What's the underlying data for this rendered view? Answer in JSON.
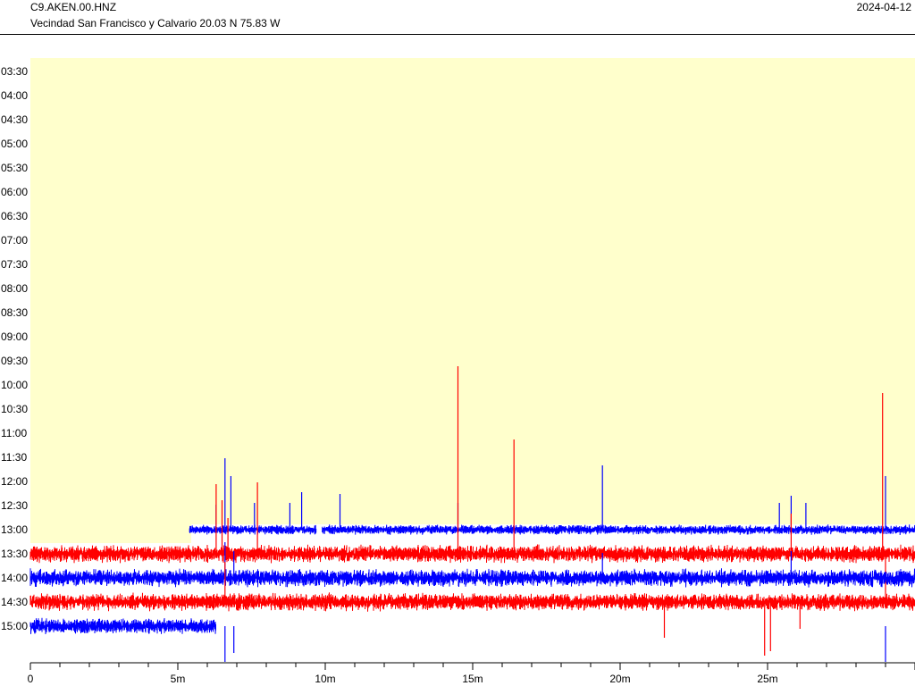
{
  "header": {
    "station": "C9.AKEN.00.HNZ",
    "location": "Vecindad San Francisco y Calvario  20.03 N 75.83 W",
    "date": "2024-04-12"
  },
  "chart_data": {
    "type": "line",
    "title": "C9.AKEN.00.HNZ",
    "row_labels": [
      "03:30",
      "04:00",
      "04:30",
      "05:00",
      "05:30",
      "06:00",
      "06:30",
      "07:00",
      "07:30",
      "08:00",
      "08:30",
      "09:00",
      "09:30",
      "10:00",
      "10:30",
      "11:00",
      "11:30",
      "12:00",
      "12:30",
      "13:00",
      "13:30",
      "14:00",
      "14:30",
      "15:00"
    ],
    "x_ticks": [
      "0",
      "5m",
      "10m",
      "15m",
      "20m",
      "25m"
    ],
    "x_range_minutes": [
      0,
      30
    ],
    "rows_with_data": [
      {
        "label": "13:00",
        "color": "#0000ff",
        "start_min": 5.4,
        "end_min": 30,
        "gap_min": [
          9.7,
          9.9
        ],
        "noise": 5,
        "spikes": [
          [
            6.3,
            -28
          ],
          [
            6.6,
            -80
          ],
          [
            6.8,
            -60
          ],
          [
            7.6,
            -30
          ],
          [
            8.8,
            -30
          ],
          [
            9.2,
            -42
          ],
          [
            10.5,
            -40
          ],
          [
            14.5,
            -30
          ],
          [
            19.4,
            -72
          ],
          [
            25.4,
            -30
          ],
          [
            25.8,
            -38
          ],
          [
            26.3,
            -30
          ],
          [
            29.0,
            -60
          ]
        ]
      },
      {
        "label": "13:30",
        "color": "#ff0000",
        "start_min": 0,
        "end_min": 30,
        "noise": 9,
        "spikes": [
          [
            6.3,
            -78
          ],
          [
            6.5,
            -60
          ],
          [
            6.7,
            -40
          ],
          [
            7.7,
            -80
          ],
          [
            14.5,
            -210
          ],
          [
            16.4,
            -128
          ],
          [
            25.8,
            -45
          ],
          [
            28.9,
            -180
          ],
          [
            29.0,
            50
          ]
        ]
      },
      {
        "label": "14:00",
        "color": "#0000ff",
        "start_min": 0,
        "end_min": 30,
        "noise": 9,
        "spikes": [
          [
            6.6,
            -40
          ],
          [
            6.9,
            -30
          ],
          [
            19.4,
            -28
          ],
          [
            25.8,
            -30
          ]
        ]
      },
      {
        "label": "14:30",
        "color": "#ff0000",
        "start_min": 0,
        "end_min": 30,
        "noise": 9,
        "spikes": [
          [
            6.6,
            -45
          ],
          [
            21.5,
            40
          ],
          [
            24.9,
            60
          ],
          [
            25.1,
            55
          ],
          [
            26.1,
            30
          ]
        ]
      },
      {
        "label": "15:00",
        "color": "#0000ff",
        "start_min": 0,
        "end_min": 6.3,
        "noise": 8,
        "spikes": [
          [
            6.6,
            40
          ],
          [
            6.9,
            30
          ],
          [
            29.0,
            40
          ]
        ]
      }
    ],
    "background_colors": {
      "past": "#ffffcc",
      "future": "#ffffff"
    },
    "grid": false
  }
}
